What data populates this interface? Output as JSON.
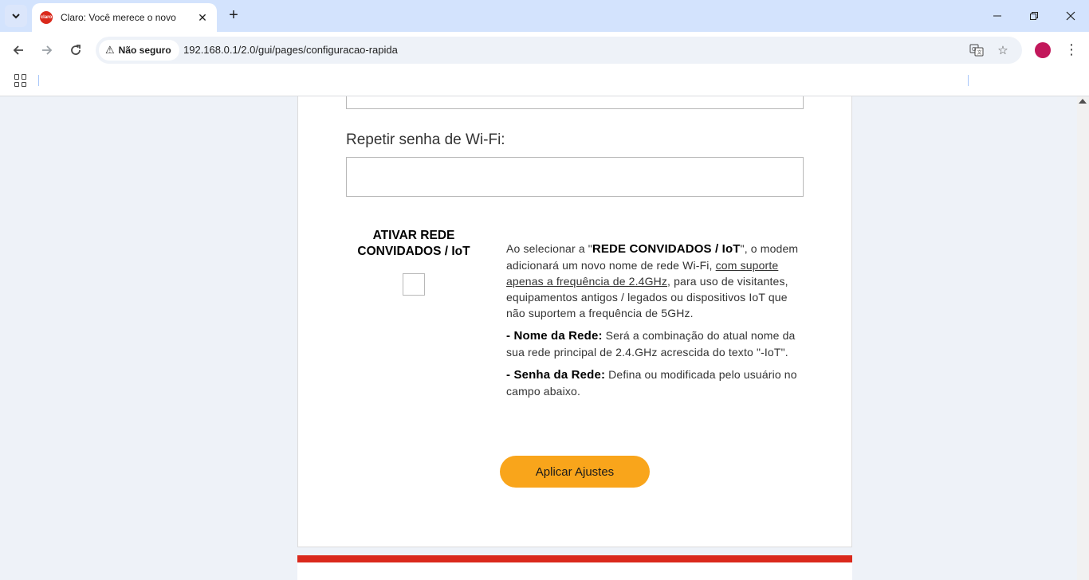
{
  "browser": {
    "tab_title": "Claro: Você merece o novo",
    "favicon_text": "claro",
    "new_tab_symbol": "+",
    "security_label": "Não seguro",
    "url": "192.168.0.1/2.0/gui/pages/configuracao-rapida",
    "icons": [
      "chevron-down-icon",
      "close-icon",
      "plus-icon",
      "minimize-icon",
      "restore-icon",
      "back-icon",
      "forward-icon",
      "reload-icon",
      "warning-icon",
      "translate-icon",
      "star-icon",
      "profile-avatar",
      "more-vert-icon",
      "apps-icon"
    ],
    "profile_color": "#c2185b"
  },
  "form": {
    "repeat_password_label": "Repetir senha de Wi-Fi:",
    "repeat_password_value": "",
    "iot_title_line1": "ATIVAR REDE",
    "iot_title_line2": "CONVIDADOS / IoT",
    "iot_checked": false,
    "desc_p1_pre": "Ao selecionar a \"",
    "desc_p1_bold": "REDE CONVIDADOS / IoT",
    "desc_p1_mid": "\", o modem adicionará um novo nome de rede Wi-Fi, ",
    "desc_p1_underline": "com suporte apenas a frequência de 2.4GHz",
    "desc_p1_post": ", para uso de visitantes, equipamentos antigos / legados ou dispositivos IoT que não suportem a frequência de 5GHz.",
    "desc_p2_bold": "- Nome da Rede:",
    "desc_p2_text": " Será a combinação do atual nome da sua rede principal de 2.4.GHz acrescida do texto \"-IoT\".",
    "desc_p3_bold": "- Senha da Rede:",
    "desc_p3_text": " Defina ou modificada pelo usuário no campo abaixo.",
    "apply_button": "Aplicar Ajustes"
  },
  "colors": {
    "brand_red": "#da291c",
    "button_orange": "#f9a51b",
    "tabstrip": "#d3e3fd"
  }
}
